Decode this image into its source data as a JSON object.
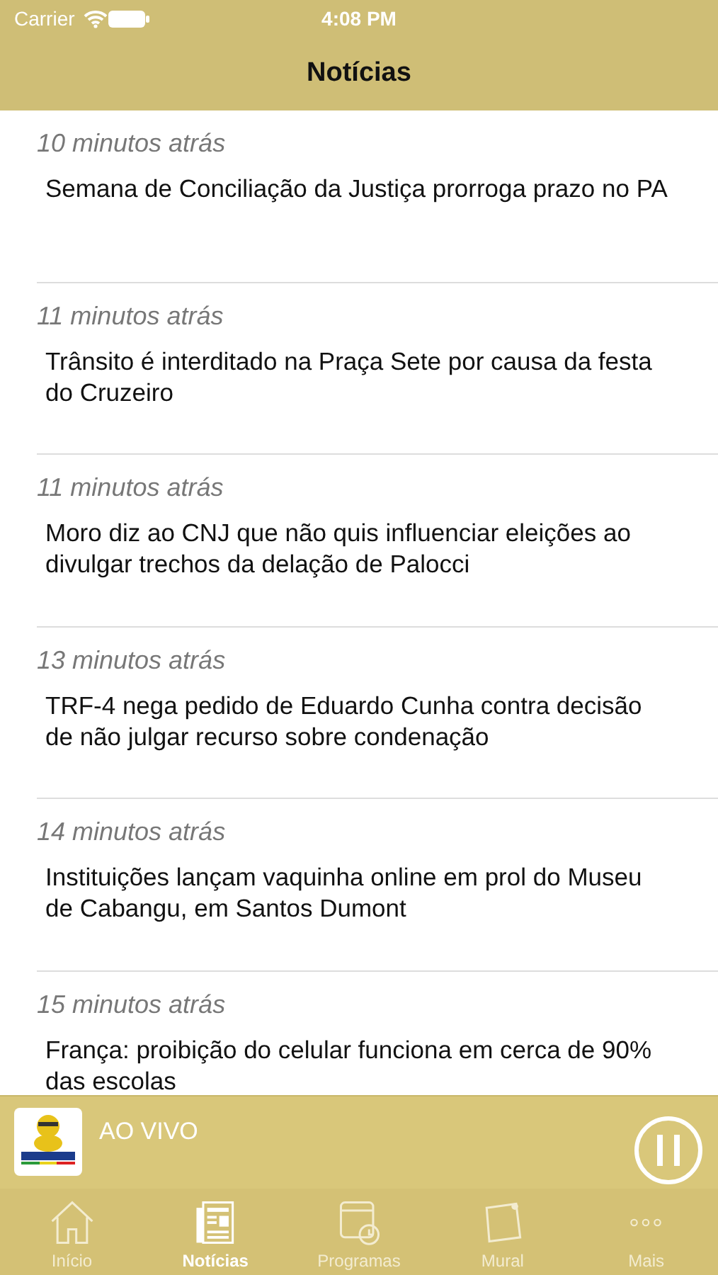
{
  "status_bar": {
    "carrier": "Carrier",
    "time": "4:08 PM"
  },
  "nav": {
    "title": "Notícias"
  },
  "news": [
    {
      "time": "10 minutos atrás",
      "title": "Semana de Conciliação da Justiça prorroga prazo no PA"
    },
    {
      "time": "11 minutos atrás",
      "title": "Trânsito é interditado na Praça Sete por causa da festa do Cruzeiro"
    },
    {
      "time": "11 minutos atrás",
      "title": "Moro diz ao CNJ que não quis influenciar eleições ao divulgar trechos da delação de Palocci"
    },
    {
      "time": "13 minutos atrás",
      "title": "TRF-4 nega pedido de Eduardo Cunha contra decisão de não julgar recurso sobre condenação"
    },
    {
      "time": "14 minutos atrás",
      "title": "Instituições lançam vaquinha online em prol do Museu de Cabangu, em Santos Dumont"
    },
    {
      "time": "15 minutos atrás",
      "title": "França: proibição do celular funciona em cerca de 90% das escolas"
    }
  ],
  "player": {
    "label": "AO VIVO",
    "playing": true
  },
  "tabs": [
    {
      "kind": "home",
      "label": "Início",
      "selected": false
    },
    {
      "kind": "news",
      "label": "Notícias",
      "selected": true
    },
    {
      "kind": "calendar",
      "label": "Programas",
      "selected": false
    },
    {
      "kind": "note",
      "label": "Mural",
      "selected": false
    },
    {
      "kind": "more",
      "label": "Mais",
      "selected": false
    }
  ]
}
